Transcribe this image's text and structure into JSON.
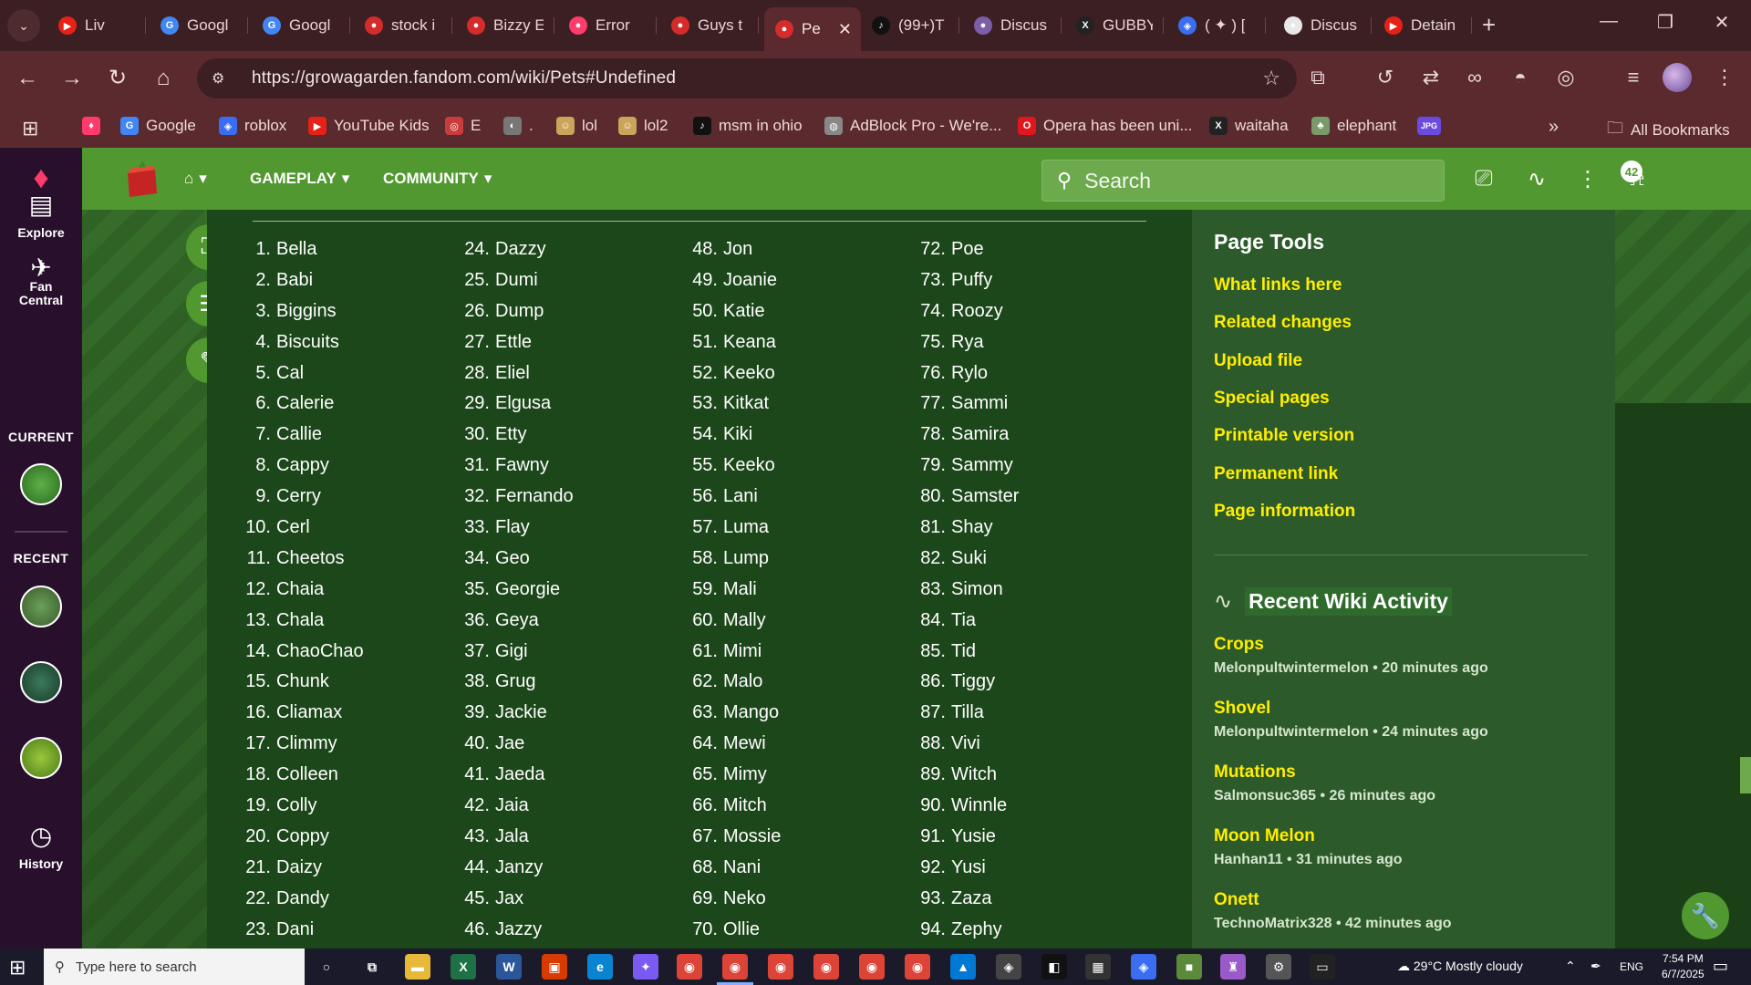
{
  "browser": {
    "tabs": [
      {
        "title": "Liv",
        "favicon_color": "#e62117",
        "favicon_glyph": "▶"
      },
      {
        "title": "Googl",
        "favicon_color": "#4285f4",
        "favicon_glyph": "G"
      },
      {
        "title": "Googl",
        "favicon_color": "#4285f4",
        "favicon_glyph": "G"
      },
      {
        "title": "stock i",
        "favicon_color": "#d62b2b",
        "favicon_glyph": "●"
      },
      {
        "title": "Bizzy E",
        "favicon_color": "#d62b2b",
        "favicon_glyph": "●"
      },
      {
        "title": "Error",
        "favicon_color": "#ff3b6b",
        "favicon_glyph": "●"
      },
      {
        "title": "Guys t",
        "favicon_color": "#d62b2b",
        "favicon_glyph": "●"
      },
      {
        "title": "Pe",
        "favicon_color": "#d62b2b",
        "favicon_glyph": "●"
      },
      {
        "title": "(99+)T",
        "favicon_color": "#111111",
        "favicon_glyph": "♪"
      },
      {
        "title": "Discus",
        "favicon_color": "#7b5ea7",
        "favicon_glyph": "●"
      },
      {
        "title": "GUBBY",
        "favicon_color": "#222222",
        "favicon_glyph": "X"
      },
      {
        "title": "( ✦ ) [",
        "favicon_color": "#3a6df0",
        "favicon_glyph": "◈"
      },
      {
        "title": "Discus",
        "favicon_color": "#e8e8e8",
        "favicon_glyph": "●"
      },
      {
        "title": "Detain",
        "favicon_color": "#e62117",
        "favicon_glyph": "▶"
      }
    ],
    "url": "https://growagarden.fandom.com/wiki/Pets#Undefined",
    "bookmarks": [
      {
        "label": "",
        "color": "#ff3b6b",
        "glyph": "♦"
      },
      {
        "label": "Google",
        "color": "#4285f4",
        "glyph": "G"
      },
      {
        "label": "roblox",
        "color": "#3a6df0",
        "glyph": "◈"
      },
      {
        "label": "YouTube Kids",
        "color": "#e62117",
        "glyph": "▶"
      },
      {
        "label": "E",
        "color": "#c83c3c",
        "glyph": "◎"
      },
      {
        "label": ".",
        "color": "#777777",
        "glyph": "◐"
      },
      {
        "label": "lol",
        "color": "#c9a45a",
        "glyph": "☺"
      },
      {
        "label": "lol2",
        "color": "#c9a45a",
        "glyph": "☺"
      },
      {
        "label": "msm in ohio",
        "color": "#111111",
        "glyph": "♪"
      },
      {
        "label": "AdBlock Pro - We're...",
        "color": "#888888",
        "glyph": "◍"
      },
      {
        "label": "Opera has been uni...",
        "color": "#e2161d",
        "glyph": "O"
      },
      {
        "label": "waitaha",
        "color": "#222222",
        "glyph": "X"
      },
      {
        "label": "elephant",
        "color": "#7a9a6a",
        "glyph": "♣"
      },
      {
        "label": "",
        "color": "#6b4adf",
        "glyph": "JPG"
      }
    ],
    "all_bookmarks_label": "All Bookmarks"
  },
  "rail": {
    "explore_label": "Explore",
    "fan_central_label": "Fan\nCentral",
    "current_heading": "CURRENT",
    "recent_heading": "RECENT",
    "history_label": "History"
  },
  "header": {
    "gameplay_label": "GAMEPLAY",
    "community_label": "COMMUNITY",
    "search_placeholder": "Search",
    "notification_count": "42"
  },
  "pets": {
    "col1": [
      "Bella",
      "Babi",
      "Biggins",
      "Biscuits",
      "Cal",
      "Calerie",
      "Callie",
      "Cappy",
      "Cerry",
      "Cerl",
      "Cheetos",
      "Chaia",
      "Chala",
      "ChaoChao",
      "Chunk",
      "Cliamax",
      "Climmy",
      "Colleen",
      "Colly",
      "Coppy",
      "Daizy",
      "Dandy",
      "Dani"
    ],
    "col2": [
      "Dazzy",
      "Dumi",
      "Dump",
      "Ettle",
      "Eliel",
      "Elgusa",
      "Etty",
      "Fawny",
      "Fernando",
      "Flay",
      "Geo",
      "Georgie",
      "Geya",
      "Gigi",
      "Grug",
      "Jackie",
      "Jae",
      "Jaeda",
      "Jaia",
      "Jala",
      "Janzy",
      "Jax",
      "Jazzy"
    ],
    "col3": [
      "Jon",
      "Joanie",
      "Katie",
      "Keana",
      "Keeko",
      "Kitkat",
      "Kiki",
      "Keeko",
      "Lani",
      "Luma",
      "Lump",
      "Mali",
      "Mally",
      "Mimi",
      "Malo",
      "Mango",
      "Mewi",
      "Mimy",
      "Mitch",
      "Mossie",
      "Nani",
      "Neko",
      "Ollie"
    ],
    "col4": [
      "Poe",
      "Puffy",
      "Roozy",
      "Rya",
      "Rylo",
      "Sammi",
      "Samira",
      "Sammy",
      "Samster",
      "Shay",
      "Suki",
      "Simon",
      "Tia",
      "Tid",
      "Tiggy",
      "Tilla",
      "Vivi",
      "Witch",
      "Winnle",
      "Yusie",
      "Yusi",
      "Zaza",
      "Zephy"
    ],
    "col1_start": 1,
    "col2_start": 24,
    "col3_start": 48,
    "col4_start": 72
  },
  "page_tools": {
    "heading": "Page Tools",
    "links": [
      "What links here",
      "Related changes",
      "Upload file",
      "Special pages",
      "Printable version",
      "Permanent link",
      "Page information"
    ]
  },
  "activity": {
    "heading": "Recent Wiki Activity",
    "items": [
      {
        "title": "Crops",
        "meta": "Melonpultwintermelon • 20 minutes ago"
      },
      {
        "title": "Shovel",
        "meta": "Melonpultwintermelon • 24 minutes ago"
      },
      {
        "title": "Mutations",
        "meta": "Salmonsuc365 • 26 minutes ago"
      },
      {
        "title": "Moon Melon",
        "meta": "Hanhan11 • 31 minutes ago"
      },
      {
        "title": "Onett",
        "meta": "TechnoMatrix328 • 42 minutes ago"
      }
    ]
  },
  "taskbar": {
    "search_placeholder": "Type here to search",
    "weather": "29°C  Mostly cloudy",
    "lang": "ENG",
    "time": "7:54 PM",
    "date": "6/7/2025"
  },
  "colors": {
    "fandom_green": "#50982f",
    "link_yellow": "#ffee00",
    "content_bg": "#1c471a",
    "rail_bg": "#280f2c"
  }
}
